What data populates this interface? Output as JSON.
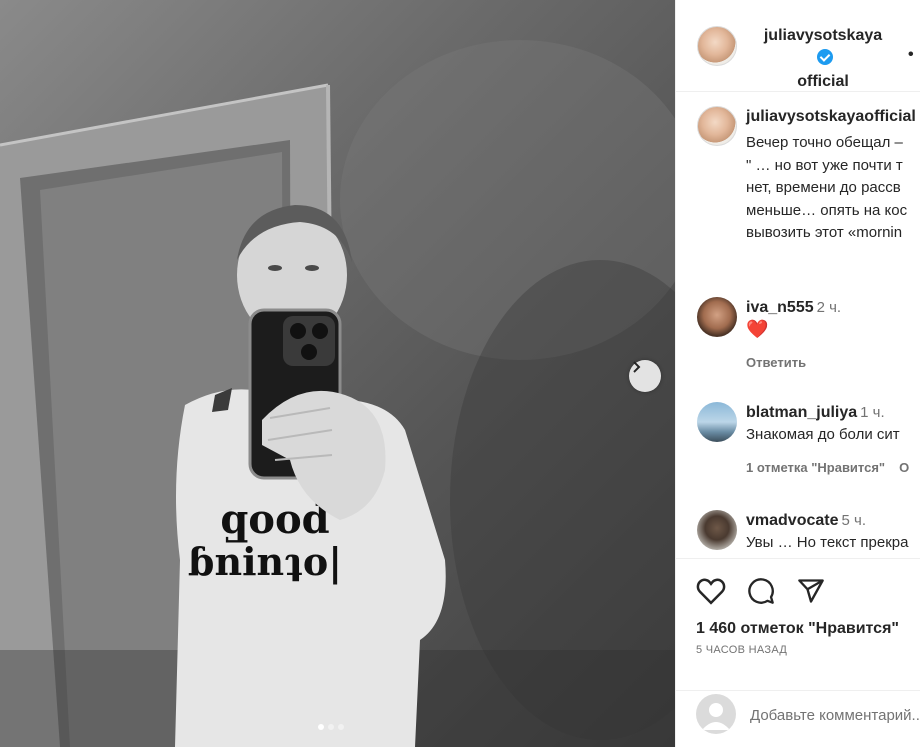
{
  "post": {
    "username": "juliavysotskayaofficial",
    "header_username_line1": "juliavysotskaya",
    "header_username_line2": "official",
    "more_glyph": "•"
  },
  "photo": {
    "sweater_text_line1": "Good",
    "sweater_text_line2": "Morning",
    "carousel_dots": 3,
    "active_dot": 1
  },
  "caption": {
    "username": "juliavysotskayaofficial",
    "lines": [
      "Вечер точно обещал –",
      "\" … но вот уже почти т",
      "нет, времени до рассв",
      "меньше… опять на кос",
      "вывозить этот «mornin"
    ]
  },
  "comments": [
    {
      "username": "iva_n555",
      "time": "2 ч.",
      "text": "❤️",
      "reply_label": "Ответить",
      "likes_label": ""
    },
    {
      "username": "blatman_juliya",
      "time": "1 ч.",
      "text": "Знакомая до боли сит",
      "likes_label": "1 отметка \"Нравится\"",
      "reply_label": "О"
    },
    {
      "username": "vmadvocate",
      "time": "5 ч.",
      "text": "Увы … Но текст прекра"
    }
  ],
  "actions": {
    "like_icon": "heart-icon",
    "comment_icon": "comment-icon",
    "share_icon": "share-icon",
    "likes_count": "1 460 отметок \"Нравится\"",
    "post_time": "5 ЧАСОВ НАЗАД"
  },
  "add_comment": {
    "placeholder": "Добавьте комментарий..."
  },
  "colors": {
    "accent_blue": "#1d9bf0",
    "heart_red": "#ed1c2a",
    "muted_text": "#737373",
    "divider": "#efefef"
  }
}
